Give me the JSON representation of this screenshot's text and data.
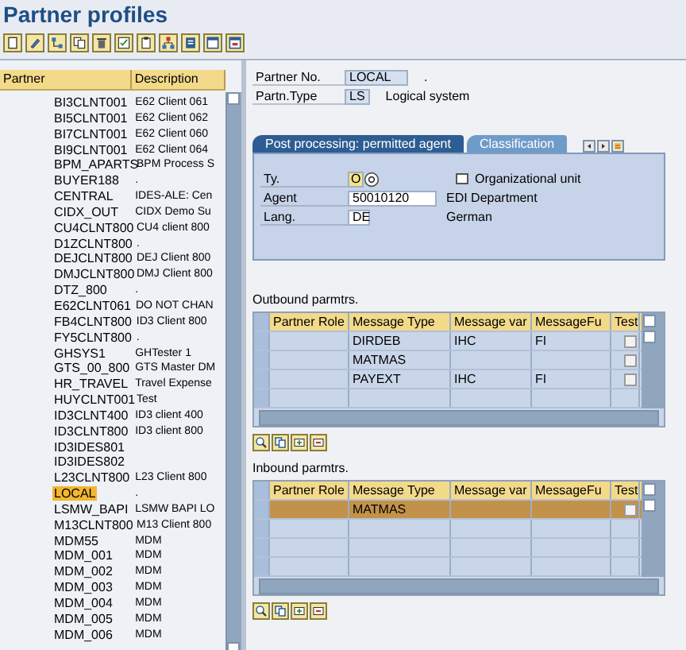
{
  "window": {
    "title": "Partner profiles"
  },
  "partner_list": {
    "columns": [
      "Partner",
      "Description"
    ],
    "rows": [
      {
        "partner": "BI3CLNT001",
        "description": "E62 Client 061",
        "selected": false
      },
      {
        "partner": "BI5CLNT001",
        "description": "E62 Client 062",
        "selected": false
      },
      {
        "partner": "BI7CLNT001",
        "description": "E62 Client 060",
        "selected": false
      },
      {
        "partner": "BI9CLNT001",
        "description": "E62 Client 064",
        "selected": false
      },
      {
        "partner": "BPM_APARTS",
        "description": "BPM Process S",
        "selected": false
      },
      {
        "partner": "BUYER188",
        "description": ".",
        "selected": false
      },
      {
        "partner": "CENTRAL",
        "description": "IDES-ALE: Cen",
        "selected": false
      },
      {
        "partner": "CIDX_OUT",
        "description": "CIDX Demo Su",
        "selected": false
      },
      {
        "partner": "CU4CLNT800",
        "description": "CU4 client 800",
        "selected": false
      },
      {
        "partner": "D1ZCLNT800",
        "description": ".",
        "selected": false
      },
      {
        "partner": "DEJCLNT800",
        "description": "DEJ Client 800",
        "selected": false
      },
      {
        "partner": "DMJCLNT800",
        "description": "DMJ Client 800",
        "selected": false
      },
      {
        "partner": "DTZ_800",
        "description": ".",
        "selected": false
      },
      {
        "partner": "E62CLNT061",
        "description": "DO NOT CHAN",
        "selected": false
      },
      {
        "partner": "FB4CLNT800",
        "description": "ID3 Client 800",
        "selected": false
      },
      {
        "partner": "FY5CLNT800",
        "description": ".",
        "selected": false
      },
      {
        "partner": "GHSYS1",
        "description": "GHTester 1",
        "selected": false
      },
      {
        "partner": "GTS_00_800",
        "description": "GTS Master DM",
        "selected": false
      },
      {
        "partner": "HR_TRAVEL",
        "description": "Travel Expense",
        "selected": false
      },
      {
        "partner": "HUYCLNT001",
        "description": "Test",
        "selected": false
      },
      {
        "partner": "ID3CLNT400",
        "description": "ID3 client 400",
        "selected": false
      },
      {
        "partner": "ID3CLNT800",
        "description": "ID3 client 800",
        "selected": false
      },
      {
        "partner": "ID3IDES801",
        "selected": false
      },
      {
        "partner": "ID3IDES802",
        "selected": false
      },
      {
        "partner": "L23CLNT800",
        "description": "L23 Client 800",
        "selected": false
      },
      {
        "partner": "LOCAL",
        "description": ".",
        "selected": true
      },
      {
        "partner": "LSMW_BAPI",
        "description": "LSMW BAPI LO",
        "selected": false
      },
      {
        "partner": "M13CLNT800",
        "description": "M13 Client 800",
        "selected": false
      },
      {
        "partner": "MDM55",
        "description": "MDM",
        "selected": false
      },
      {
        "partner": "MDM_001",
        "description": "MDM",
        "selected": false
      },
      {
        "partner": "MDM_002",
        "description": "MDM",
        "selected": false
      },
      {
        "partner": "MDM_003",
        "description": "MDM",
        "selected": false
      },
      {
        "partner": "MDM_004",
        "description": "MDM",
        "selected": false
      },
      {
        "partner": "MDM_005",
        "description": "MDM",
        "selected": false
      },
      {
        "partner": "MDM_006",
        "description": "MDM",
        "selected": false
      }
    ]
  },
  "header": {
    "partner_no": {
      "label": "Partner No.",
      "value": "LOCAL",
      "text": "."
    },
    "partner_type": {
      "label": "Partn.Type",
      "value": "LS",
      "text": "Logical system"
    }
  },
  "tabs": [
    {
      "label": "Post processing: permitted agent",
      "selected": true
    },
    {
      "label": "Classification",
      "selected": false
    }
  ],
  "agent_panel": {
    "type": {
      "label": "Ty.",
      "value": "O"
    },
    "org_unit": {
      "label": "Organizational unit",
      "checked": false
    },
    "agent": {
      "label": "Agent",
      "value": "50010120",
      "text": "EDI Department"
    },
    "language": {
      "label": "Lang.",
      "value": "DE",
      "text": "German"
    }
  },
  "outbound": {
    "title": "Outbound parmtrs.",
    "columns": [
      "Partner Role",
      "Message Type",
      "Message var",
      "MessageFu",
      "Test"
    ],
    "rows": [
      {
        "message_type": "DIRDEB",
        "message_variant": "IHC",
        "message_function": "FI",
        "test": false,
        "selected": false
      },
      {
        "message_type": "MATMAS",
        "test": false,
        "selected": false
      },
      {
        "message_type": "PAYEXT",
        "message_variant": "IHC",
        "message_function": "FI",
        "test": false,
        "selected": false
      }
    ]
  },
  "inbound": {
    "title": "Inbound parmtrs.",
    "columns": [
      "Partner Role",
      "Message Type",
      "Message var",
      "MessageFu",
      "Test"
    ],
    "rows": [
      {
        "message_type": "MATMAS",
        "test": false,
        "selected": true
      }
    ]
  }
}
